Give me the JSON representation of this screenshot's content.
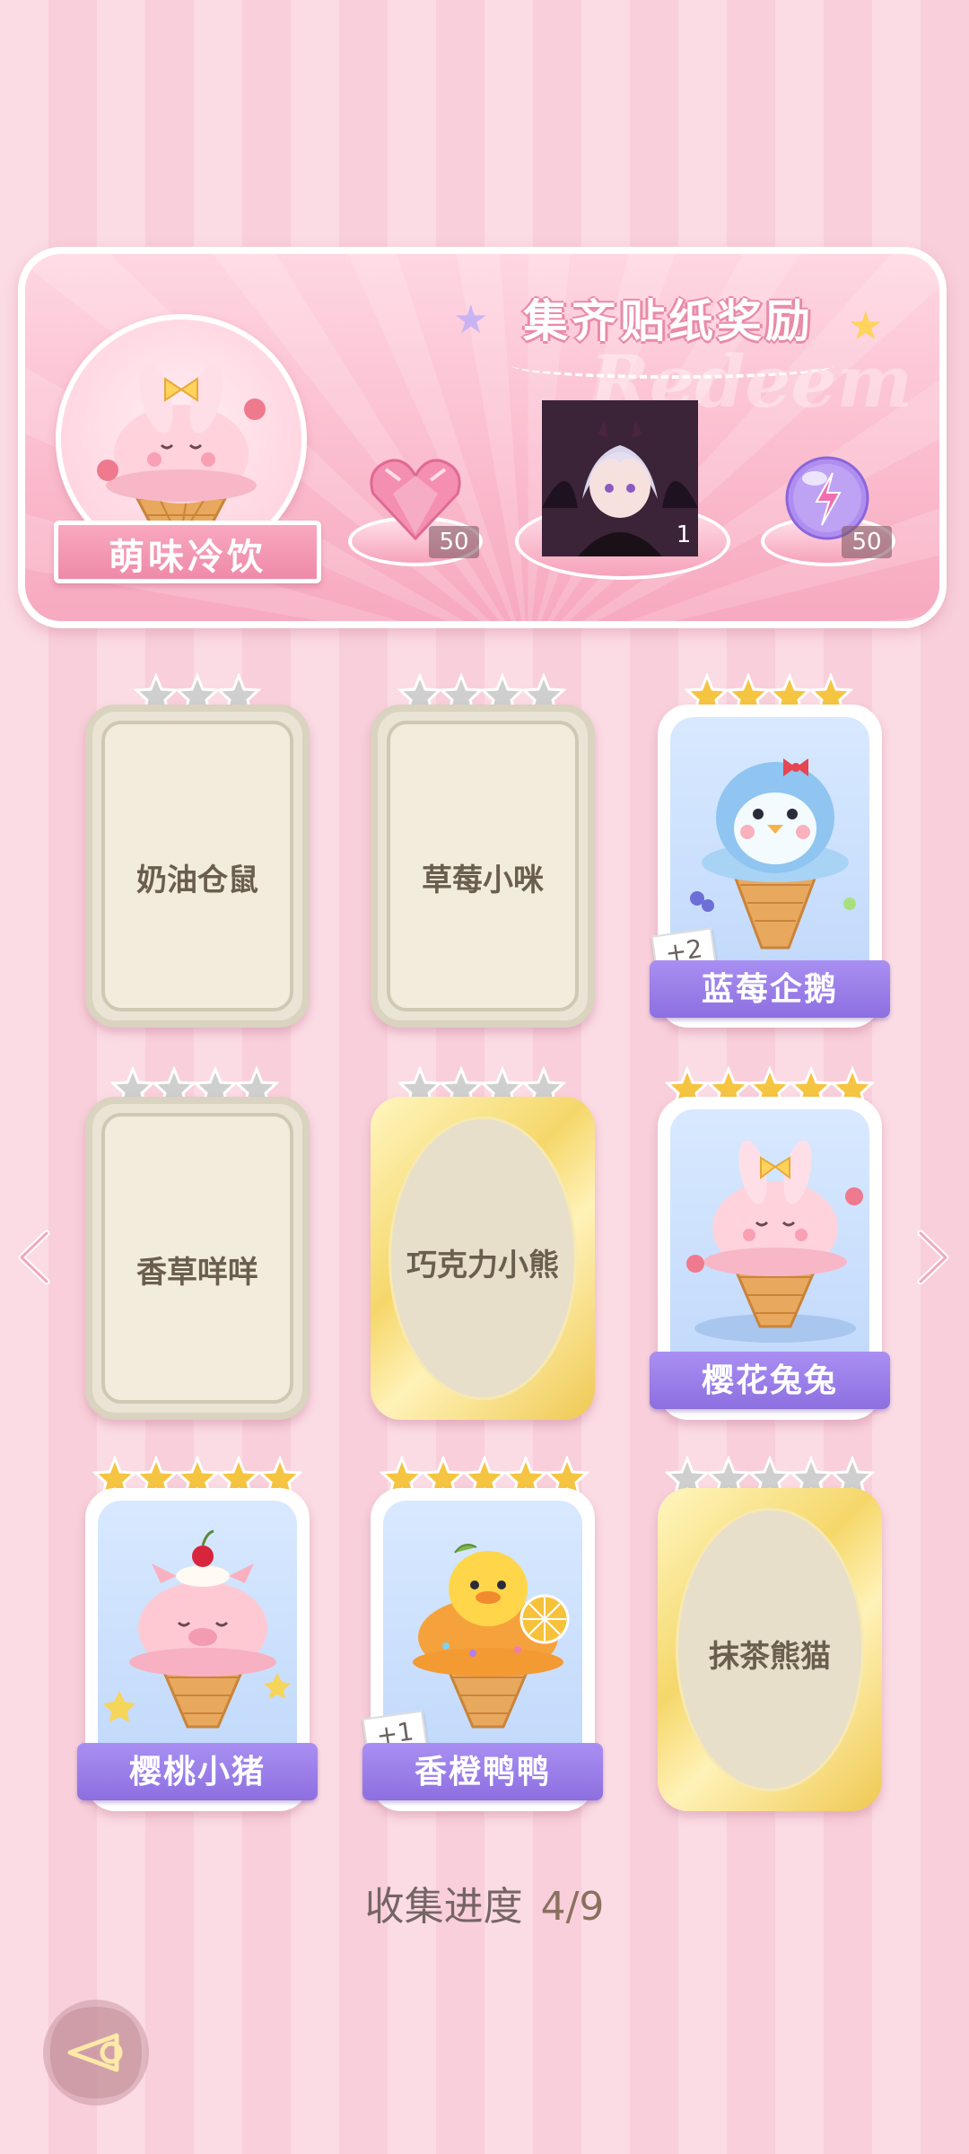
{
  "banner": {
    "title": "集齐贴纸奖励",
    "watermark": "Redeem",
    "pet_name": "萌味冷饮",
    "rewards": [
      {
        "name": "heart-gem",
        "count": "50"
      },
      {
        "name": "avatar-reward",
        "count": "1"
      },
      {
        "name": "energy-orb",
        "count": "50"
      }
    ]
  },
  "cards": [
    {
      "name": "奶油仓鼠",
      "state": "locked",
      "stars": 3,
      "filled": 0
    },
    {
      "name": "草莓小咪",
      "state": "locked",
      "stars": 4,
      "filled": 0
    },
    {
      "name": "蓝莓企鹅",
      "state": "owned",
      "stars": 4,
      "filled": 4,
      "dup": "+2"
    },
    {
      "name": "香草咩咩",
      "state": "locked",
      "stars": 4,
      "filled": 0
    },
    {
      "name": "巧克力小熊",
      "state": "rare",
      "stars": 4,
      "filled": 0
    },
    {
      "name": "樱花兔兔",
      "state": "owned",
      "stars": 5,
      "filled": 5
    },
    {
      "name": "樱桃小猪",
      "state": "owned",
      "stars": 5,
      "filled": 5
    },
    {
      "name": "香橙鸭鸭",
      "state": "owned",
      "stars": 5,
      "filled": 5,
      "dup": "+1"
    },
    {
      "name": "抹茶熊猫",
      "state": "rare",
      "stars": 5,
      "filled": 0
    }
  ],
  "progress": {
    "label": "收集进度",
    "value": "4/9"
  },
  "icons": {
    "prev": "chevron-left-icon",
    "next": "chevron-right-icon",
    "back": "back-arrow-icon"
  },
  "colors": {
    "accent": "#ef8aa8",
    "ribbon": "#8d6fe0",
    "star_gold": "#f5c542",
    "star_gray": "#c9c9c9"
  }
}
